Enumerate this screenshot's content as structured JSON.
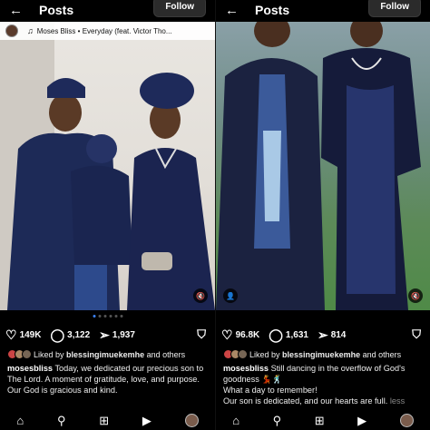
{
  "left": {
    "header": {
      "back_icon": "arrow-left-icon",
      "title": "Posts",
      "follow_label": "Follow"
    },
    "music": {
      "artist": "Moses Bliss",
      "track": "Everyday (feat. Victor Tho..."
    },
    "carousel_dots": 6,
    "actions": {
      "likes": "149K",
      "comments": "3,122",
      "shares": "1,937"
    },
    "liked_by": {
      "prefix": "Liked by",
      "user": "blessingimuekemhe",
      "suffix": "and others"
    },
    "caption": {
      "username": "mosesbliss",
      "text": "Today, we dedicated our precious son to The Lord. A moment of gratitude, love, and purpose. Our God is gracious and kind."
    }
  },
  "right": {
    "header": {
      "back_icon": "arrow-left-icon",
      "title": "Posts",
      "follow_label": "Follow"
    },
    "actions": {
      "likes": "96.8K",
      "comments": "1,631",
      "shares": "814"
    },
    "liked_by": {
      "prefix": "Liked by",
      "user": "blessingimuekemhe",
      "suffix": "and others"
    },
    "caption": {
      "username": "mosesbliss",
      "text": "Still dancing in the overflow of God's goodness 💃🕺",
      "line2": "What a day to remember!",
      "line3": "Our son is dedicated, and our hearts are full.",
      "more": "less"
    }
  },
  "nav": [
    "home-icon",
    "search-icon",
    "create-icon",
    "reels-icon",
    "profile-avatar"
  ],
  "colors": {
    "accent_blue": "#3b82f6",
    "navy_attire": "#1d2a57",
    "bg": "#000000"
  }
}
